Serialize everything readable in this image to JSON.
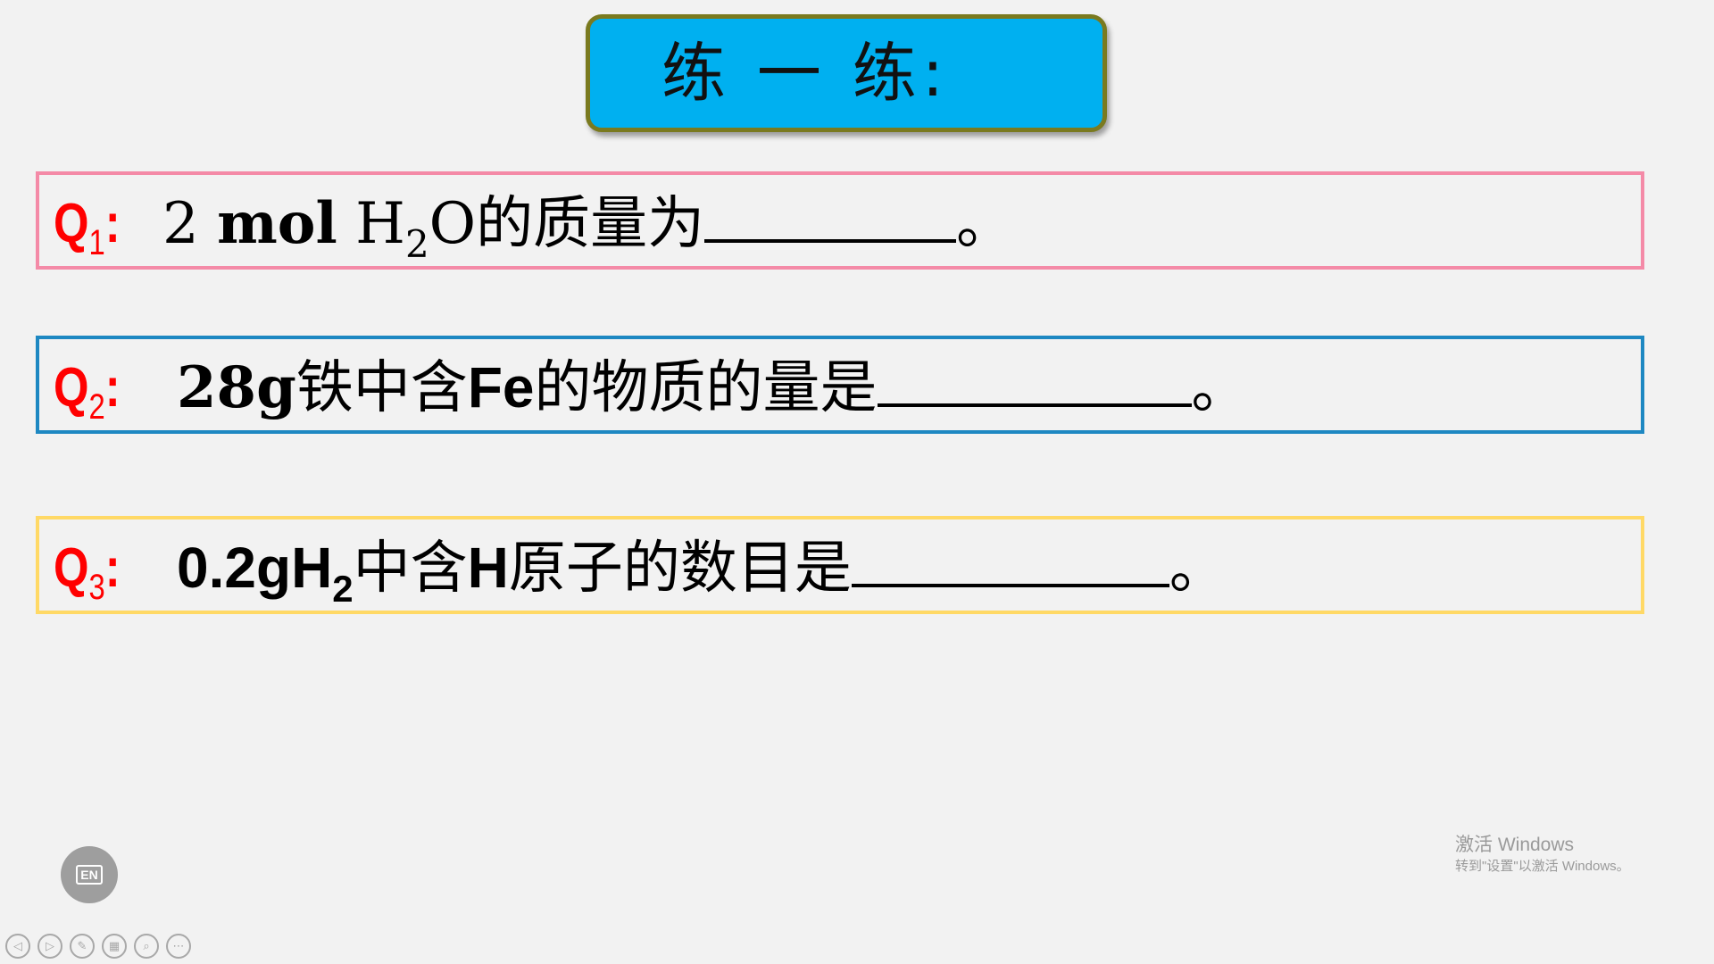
{
  "title": "练 一 练:",
  "questions": [
    {
      "label": "Q",
      "number": "1",
      "colon": ":",
      "parts": [
        "2 ",
        "mol",
        " H",
        "2",
        "O",
        "的质量为",
        "。"
      ]
    },
    {
      "label": "Q",
      "number": "2",
      "colon": ":",
      "parts": [
        "28g",
        "铁中含",
        "Fe",
        "的物质的量是",
        "。"
      ]
    },
    {
      "label": "Q",
      "number": "3",
      "colon": ":",
      "parts": [
        "0.2gH",
        "2",
        "中含",
        "H",
        "原子的数目是",
        "。"
      ]
    }
  ],
  "watermark": {
    "line1": "激活 Windows",
    "line2": "转到\"设置\"以激活 Windows。"
  },
  "lang_button": "EN",
  "toolbar": {
    "prev": "◁",
    "next": "▷",
    "pen": "✎",
    "slides": "▦",
    "zoom": "⌕",
    "more": "⋯"
  },
  "icons": {
    "prev": "prev-slide-icon",
    "next": "next-slide-icon",
    "pen": "pen-icon",
    "slides": "slides-grid-icon",
    "zoom": "zoom-icon",
    "more": "more-icon"
  },
  "colors": {
    "title_bg": "#00b0f0",
    "title_border": "#7a7a1f",
    "q1_border": "#f48aa7",
    "q2_border": "#1e88c2",
    "q3_border": "#ffd966",
    "label_color": "#ff0000"
  }
}
